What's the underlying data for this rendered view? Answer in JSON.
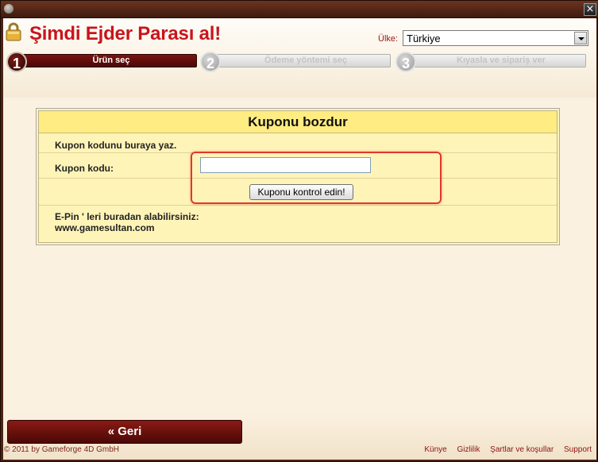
{
  "window": {
    "close_label": "×"
  },
  "header": {
    "title": "Şimdi Ejder Parası al!",
    "country_label": "Ülke:",
    "country_value": "Türkiye"
  },
  "steps": [
    {
      "number": "1",
      "label": "Ürün seç",
      "state": "active"
    },
    {
      "number": "2",
      "label": "Ödeme yöntemi seç",
      "state": "inactive"
    },
    {
      "number": "3",
      "label": "Kıyasla ve sipariş ver",
      "state": "inactive"
    }
  ],
  "coupon": {
    "heading": "Kuponu bozdur",
    "instruction": "Kupon kodunu buraya yaz.",
    "code_label": "Kupon kodu:",
    "code_value": "",
    "check_button": "Kuponu kontrol edin!",
    "epin_text": "E-Pin ' leri buradan alabilirsiniz:",
    "epin_site": "www.gamesultan.com"
  },
  "footer": {
    "back_button": "« Geri",
    "copyright": "© 2011 by Gameforge 4D GmbH",
    "links": [
      "Künye",
      "Gizlilik",
      "Şartlar ve koşullar",
      "Support"
    ]
  },
  "colors": {
    "accent_red": "#c8151c",
    "dark_red": "#4a0806",
    "panel_yellow": "#fff4b8",
    "highlight": "#e0382c"
  },
  "icons": {
    "lock": "lock-icon",
    "dropdown": "chevron-down-icon",
    "close": "close-icon"
  }
}
